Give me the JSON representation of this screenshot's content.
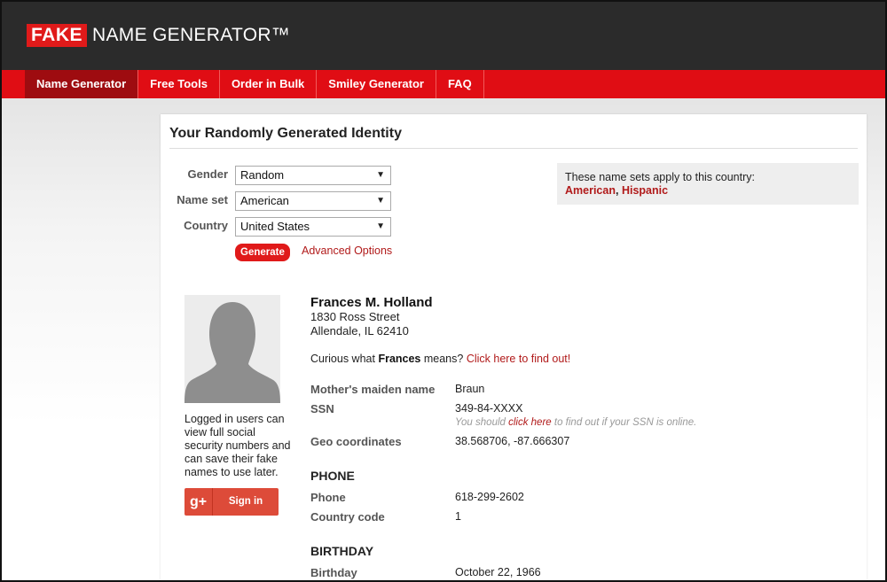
{
  "header": {
    "logo_fake": "FAKE",
    "logo_rest": "NAME GENERATOR™"
  },
  "nav": [
    {
      "label": "Name Generator",
      "active": true
    },
    {
      "label": "Free Tools",
      "active": false
    },
    {
      "label": "Order in Bulk",
      "active": false
    },
    {
      "label": "Smiley Generator",
      "active": false
    },
    {
      "label": "FAQ",
      "active": false
    }
  ],
  "page": {
    "title": "Your Randomly Generated Identity"
  },
  "form": {
    "gender_label": "Gender",
    "gender_value": "Random",
    "nameset_label": "Name set",
    "nameset_value": "American",
    "country_label": "Country",
    "country_value": "United States",
    "generate_label": "Generate",
    "advanced_label": "Advanced Options"
  },
  "nameset_info": {
    "text": "These name sets apply to this country:",
    "link1": "American",
    "separator": ", ",
    "link2": "Hispanic"
  },
  "sidebar": {
    "login_note": "Logged in users can view full social security numbers and can save their fake names to use later.",
    "gplus_icon": "g+",
    "signin_label": "Sign in"
  },
  "identity": {
    "name": "Frances M. Holland",
    "street": "1830 Ross Street",
    "city_line": "Allendale, IL 62410",
    "curious_prefix": "Curious what ",
    "first_name": "Frances",
    "curious_suffix": " means? ",
    "curious_link": "Click here to find out!",
    "maiden_label": "Mother's maiden name",
    "maiden_value": "Braun",
    "ssn_label": "SSN",
    "ssn_value": "349-84-XXXX",
    "ssn_note_prefix": "You should ",
    "ssn_note_link": "click here",
    "ssn_note_suffix": " to find out if your SSN is online.",
    "geo_label": "Geo coordinates",
    "geo_value": "38.568706, -87.666307",
    "phone_section": "PHONE",
    "phone_label": "Phone",
    "phone_value": "618-299-2602",
    "country_code_label": "Country code",
    "country_code_value": "1",
    "birthday_section": "BIRTHDAY",
    "birthday_label": "Birthday",
    "birthday_value": "October 22, 1966"
  },
  "colors": {
    "header_bg": "#2b2b2b",
    "nav_bg": "#e00d14",
    "nav_active": "#9e0c10",
    "link_red": "#b11a1a",
    "gplus_red": "#dd4b39"
  }
}
